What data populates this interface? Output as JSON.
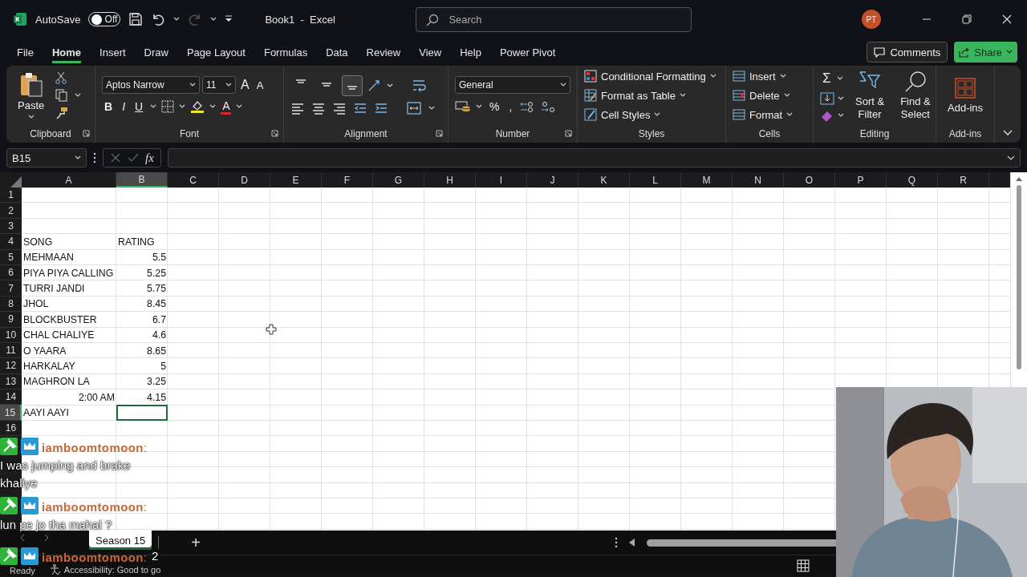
{
  "title_bar": {
    "autosave_label": "AutoSave",
    "autosave": {
      "on": false,
      "label": "Off"
    },
    "title": "Book1  -  Excel",
    "search": {
      "placeholder": "Search"
    },
    "avatar": "PT"
  },
  "tabs": [
    {
      "label": "File",
      "selected": false
    },
    {
      "label": "Home",
      "selected": true
    },
    {
      "label": "Insert",
      "selected": false
    },
    {
      "label": "Draw",
      "selected": false
    },
    {
      "label": "Page Layout",
      "selected": false
    },
    {
      "label": "Formulas",
      "selected": false
    },
    {
      "label": "Data",
      "selected": false
    },
    {
      "label": "Review",
      "selected": false
    },
    {
      "label": "View",
      "selected": false
    },
    {
      "label": "Help",
      "selected": false
    },
    {
      "label": "Power Pivot",
      "selected": false
    }
  ],
  "actions": {
    "comments": "Comments",
    "share": "Share"
  },
  "ribbon": {
    "clipboard": {
      "paste": "Paste",
      "label": "Clipboard"
    },
    "font": {
      "name": "Aptos Narrow",
      "size": "11",
      "grow": "A",
      "shrink": "A",
      "styles": [
        {
          "label": "B",
          "kind": "bold"
        },
        {
          "label": "I",
          "kind": "italic"
        },
        {
          "label": "U",
          "kind": "underline"
        }
      ],
      "font_color": "A",
      "label": "Font"
    },
    "alignment": {
      "vertical": [
        {
          "selected": false
        },
        {
          "selected": false
        },
        {
          "selected": true
        }
      ],
      "label": "Alignment"
    },
    "number": {
      "format": "General",
      "percent": "%",
      "comma": ",",
      "label": "Number"
    },
    "styles": {
      "items": [
        "Conditional Formatting",
        "Format as Table",
        "Cell Styles"
      ],
      "label": "Styles"
    },
    "cells": {
      "items": [
        "Insert",
        "Delete",
        "Format"
      ],
      "label": "Cells"
    },
    "editing": {
      "sum": "Σ",
      "sort": "Sort &\nFilter",
      "find": "Find &\nSelect",
      "label": "Editing"
    },
    "addins": {
      "button": "Add-ins",
      "label": "Add-ins"
    }
  },
  "formula_bar": {
    "name_box": "B15",
    "fx": "fx"
  },
  "columns": [
    {
      "label": "A",
      "selected": false
    },
    {
      "label": "B",
      "selected": true
    },
    {
      "label": "C",
      "selected": false
    },
    {
      "label": "D",
      "selected": false
    },
    {
      "label": "E",
      "selected": false
    },
    {
      "label": "F",
      "selected": false
    },
    {
      "label": "G",
      "selected": false
    },
    {
      "label": "H",
      "selected": false
    },
    {
      "label": "I",
      "selected": false
    },
    {
      "label": "J",
      "selected": false
    },
    {
      "label": "K",
      "selected": false
    },
    {
      "label": "L",
      "selected": false
    },
    {
      "label": "M",
      "selected": false
    },
    {
      "label": "N",
      "selected": false
    },
    {
      "label": "O",
      "selected": false
    },
    {
      "label": "P",
      "selected": false
    },
    {
      "label": "Q",
      "selected": false
    },
    {
      "label": "R",
      "selected": false
    }
  ],
  "rows": [
    {
      "header": "1",
      "selected": false
    },
    {
      "header": "2",
      "selected": false
    },
    {
      "header": "3",
      "selected": false
    },
    {
      "header": "4",
      "selected": false,
      "cells": [
        {
          "text": "SONG",
          "kind": "text",
          "selected": false
        },
        {
          "text": "RATING",
          "kind": "text",
          "selected": false
        }
      ]
    },
    {
      "header": "5",
      "selected": false,
      "cells": [
        {
          "text": "MEHMAAN",
          "kind": "text",
          "selected": false
        },
        {
          "text": "5.5",
          "kind": "number",
          "selected": false
        }
      ]
    },
    {
      "header": "6",
      "selected": false,
      "cells": [
        {
          "text": "PIYA PIYA CALLING",
          "kind": "text",
          "selected": false
        },
        {
          "text": "5.25",
          "kind": "number",
          "selected": false
        }
      ]
    },
    {
      "header": "7",
      "selected": false,
      "cells": [
        {
          "text": "TURRI JANDI",
          "kind": "text",
          "selected": false
        },
        {
          "text": "5.75",
          "kind": "number",
          "selected": false
        }
      ]
    },
    {
      "header": "8",
      "selected": false,
      "cells": [
        {
          "text": "JHOL",
          "kind": "text",
          "selected": false
        },
        {
          "text": "8.45",
          "kind": "number",
          "selected": false
        }
      ]
    },
    {
      "header": "9",
      "selected": false,
      "cells": [
        {
          "text": "BLOCKBUSTER",
          "kind": "text",
          "selected": false
        },
        {
          "text": "6.7",
          "kind": "number",
          "selected": false
        }
      ]
    },
    {
      "header": "10",
      "selected": false,
      "cells": [
        {
          "text": "CHAL CHALIYE",
          "kind": "text",
          "selected": false
        },
        {
          "text": "4.6",
          "kind": "number",
          "selected": false
        }
      ]
    },
    {
      "header": "11",
      "selected": false,
      "cells": [
        {
          "text": "O YAARA",
          "kind": "text",
          "selected": false
        },
        {
          "text": "8.65",
          "kind": "number",
          "selected": false
        }
      ]
    },
    {
      "header": "12",
      "selected": false,
      "cells": [
        {
          "text": "HARKALAY",
          "kind": "text",
          "selected": false
        },
        {
          "text": "5",
          "kind": "number",
          "selected": false
        }
      ]
    },
    {
      "header": "13",
      "selected": false,
      "cells": [
        {
          "text": "MAGHRON LA",
          "kind": "text",
          "selected": false
        },
        {
          "text": "3.25",
          "kind": "number",
          "selected": false
        }
      ]
    },
    {
      "header": "14",
      "selected": false,
      "cells": [
        {
          "text": "2:00 AM",
          "kind": "number",
          "selected": false
        },
        {
          "text": "4.15",
          "kind": "number",
          "selected": false
        }
      ]
    },
    {
      "header": "15",
      "selected": true,
      "cells": [
        {
          "text": "AAYI AAYI",
          "kind": "text",
          "selected": false
        },
        {
          "kind": "empty",
          "selected": true
        }
      ]
    },
    {
      "header": "16",
      "selected": false
    }
  ],
  "sheets": [
    {
      "label": "Season 15",
      "selected": true
    }
  ],
  "add_sheet": "+",
  "status_bar": {
    "mode": "Ready",
    "accessibility": "Accessibility: Good to go"
  },
  "chat": [
    {
      "user": "iamboomtomoon",
      "sep": ":",
      "message": "I was jumping and brake khaliye"
    },
    {
      "user": "iamboomtomoon",
      "sep": ":",
      "message": "lun pe jo tha mahal ?"
    },
    {
      "user": "iamboomtomoon",
      "sep": ":",
      "message": "2"
    }
  ]
}
